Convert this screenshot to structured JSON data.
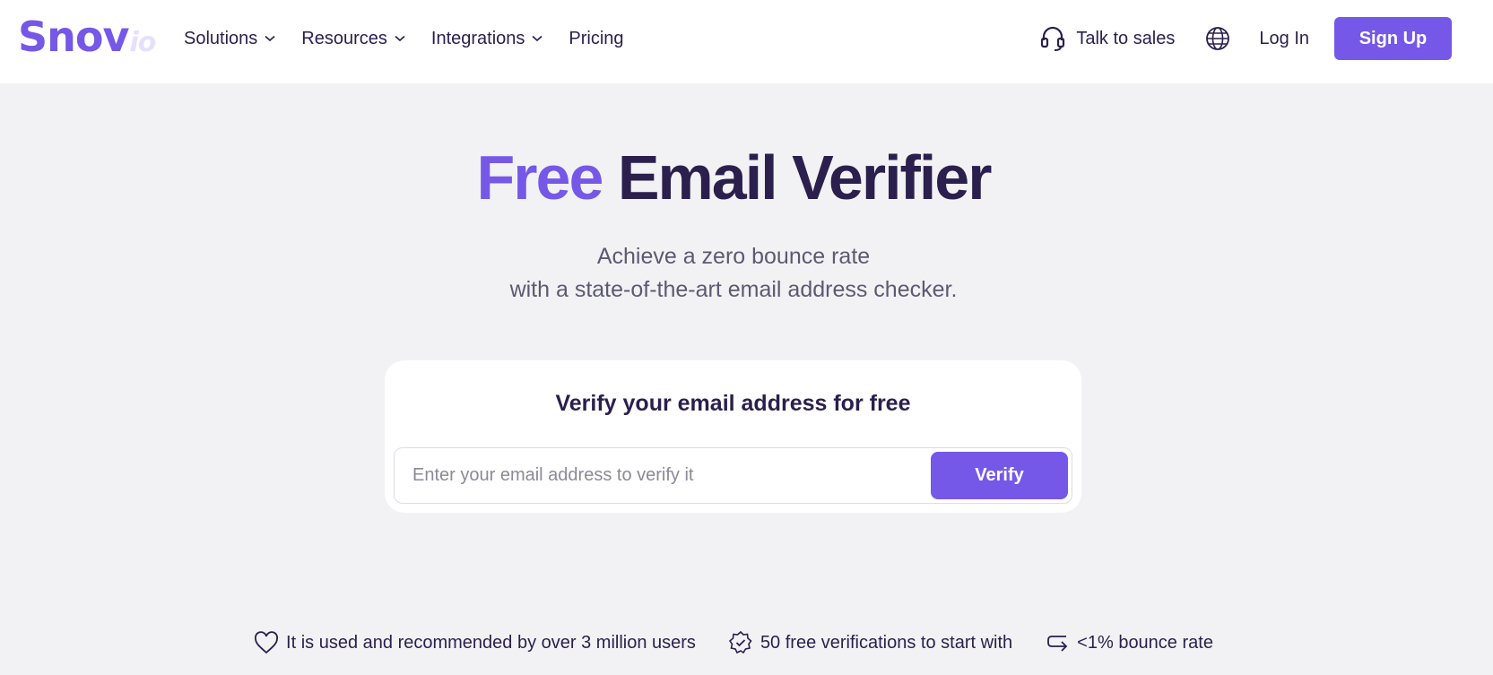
{
  "brand": {
    "logo_main": "Snov",
    "logo_sub": "io",
    "accent_color": "#7558e8",
    "dark_color": "#2a1f4d"
  },
  "nav": {
    "items": [
      {
        "label": "Solutions",
        "has_dropdown": true
      },
      {
        "label": "Resources",
        "has_dropdown": true
      },
      {
        "label": "Integrations",
        "has_dropdown": true
      },
      {
        "label": "Pricing",
        "has_dropdown": false
      }
    ],
    "talk_to_sales": "Talk to sales",
    "talk_icon": "headset-icon",
    "language_icon": "globe-icon",
    "login": "Log In",
    "signup": "Sign Up"
  },
  "hero": {
    "title_accent": "Free",
    "title_rest": "Email Verifier",
    "subtitle_line1": "Achieve a zero bounce rate",
    "subtitle_line2": "with a state-of-the-art email address checker."
  },
  "verifier": {
    "heading": "Verify your email address for free",
    "input_placeholder": "Enter your email address to verify it",
    "input_value": "",
    "button_label": "Verify"
  },
  "features": [
    {
      "icon": "heart-icon",
      "text": "It is used and recommended by over 3 million users"
    },
    {
      "icon": "verified-badge-icon",
      "text": "50 free verifications to start with"
    },
    {
      "icon": "return-arrow-icon",
      "text": "<1% bounce rate"
    }
  ]
}
